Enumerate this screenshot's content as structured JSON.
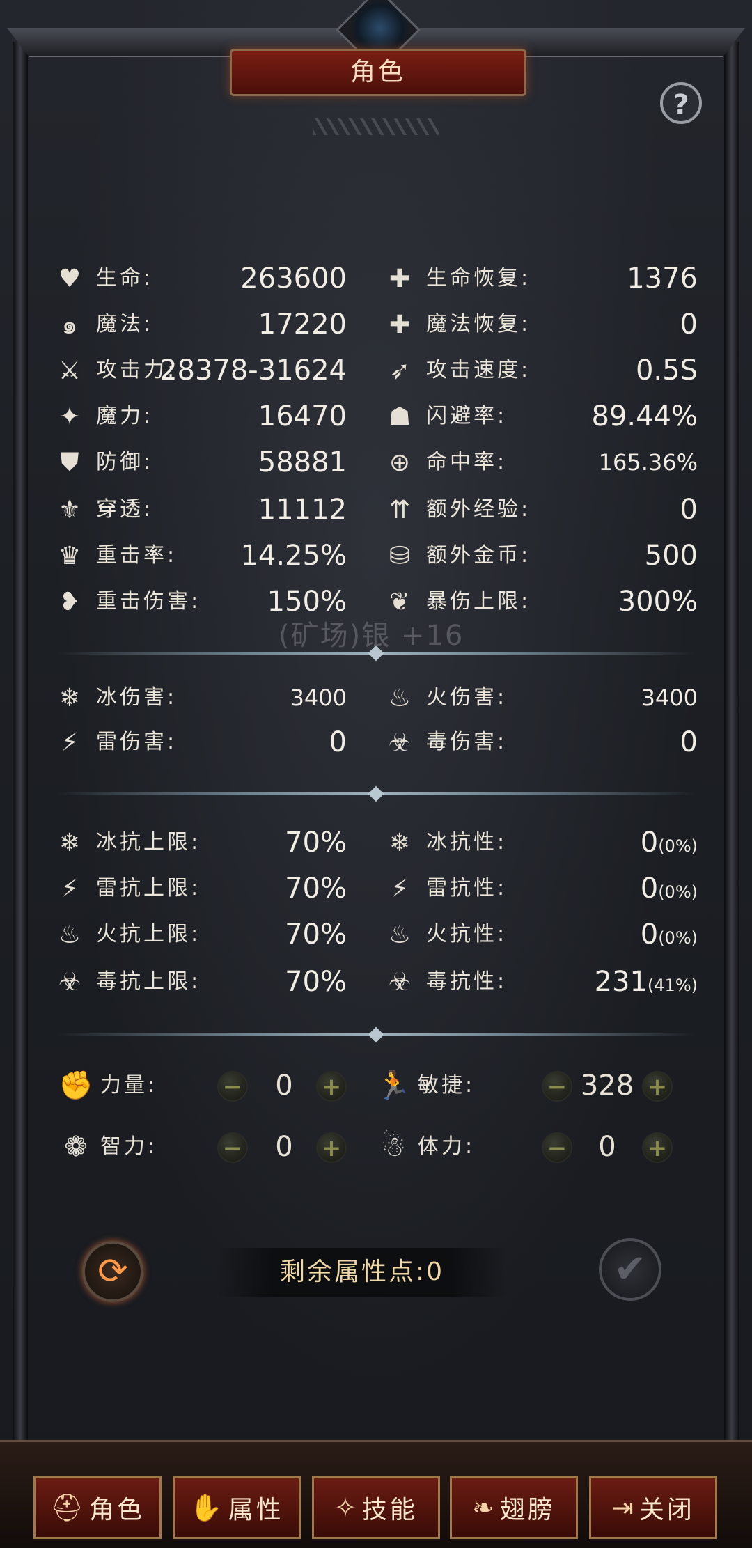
{
  "header": {
    "title": "角色",
    "help_icon": "?"
  },
  "watermark": "(矿场)银 +16",
  "stats_left": [
    {
      "icon": "heart-icon",
      "glyph": "♥",
      "label": "生命:",
      "value": "263600"
    },
    {
      "icon": "swirl-icon",
      "glyph": "๑",
      "label": "魔法:",
      "value": "17220"
    },
    {
      "icon": "sword-icon",
      "glyph": "⚔",
      "label": "攻击力:",
      "value": "28378-31624"
    },
    {
      "icon": "magic-staff-icon",
      "glyph": "✦",
      "label": "魔力:",
      "value": "16470"
    },
    {
      "icon": "shield-icon",
      "glyph": "⛊",
      "label": "防御:",
      "value": "58881"
    },
    {
      "icon": "penetrate-icon",
      "glyph": "⚜",
      "label": "穿透:",
      "value": "11112"
    },
    {
      "icon": "crit-rate-icon",
      "glyph": "♛",
      "label": "重击率:",
      "value": "14.25%"
    },
    {
      "icon": "crit-damage-icon",
      "glyph": "❥",
      "label": "重击伤害:",
      "value": "150%"
    }
  ],
  "stats_right": [
    {
      "icon": "heart-regen-icon",
      "glyph": "✚",
      "label": "生命恢复:",
      "value": "1376"
    },
    {
      "icon": "mana-regen-icon",
      "glyph": "✚",
      "label": "魔法恢复:",
      "value": "0"
    },
    {
      "icon": "attack-speed-icon",
      "glyph": "➶",
      "label": "攻击速度:",
      "value": "0.5S"
    },
    {
      "icon": "dodge-icon",
      "glyph": "☗",
      "label": "闪避率:",
      "value": "89.44%"
    },
    {
      "icon": "crosshair-icon",
      "glyph": "⊕",
      "label": "命中率:",
      "value": "165.36%"
    },
    {
      "icon": "extra-exp-icon",
      "glyph": "⇈",
      "label": "额外经验:",
      "value": "0"
    },
    {
      "icon": "extra-gold-icon",
      "glyph": "⛁",
      "label": "额外金币:",
      "value": "500"
    },
    {
      "icon": "crit-cap-icon",
      "glyph": "❦",
      "label": "暴伤上限:",
      "value": "300%"
    }
  ],
  "elemental_damage": {
    "left": [
      {
        "icon": "snowflake-icon",
        "glyph": "❄",
        "label": "冰伤害:",
        "value": "3400"
      },
      {
        "icon": "lightning-icon",
        "glyph": "⚡",
        "label": "雷伤害:",
        "value": "0"
      }
    ],
    "right": [
      {
        "icon": "fire-icon",
        "glyph": "♨",
        "label": "火伤害:",
        "value": "3400"
      },
      {
        "icon": "poison-icon",
        "glyph": "☣",
        "label": "毒伤害:",
        "value": "0"
      }
    ]
  },
  "resistances": {
    "left": [
      {
        "icon": "ice-resist-cap-icon",
        "glyph": "❄",
        "label": "冰抗上限:",
        "value": "70%"
      },
      {
        "icon": "thunder-resist-cap-icon",
        "glyph": "⚡",
        "label": "雷抗上限:",
        "value": "70%"
      },
      {
        "icon": "fire-resist-cap-icon",
        "glyph": "♨",
        "label": "火抗上限:",
        "value": "70%"
      },
      {
        "icon": "poison-resist-cap-icon",
        "glyph": "☣",
        "label": "毒抗上限:",
        "value": "70%"
      }
    ],
    "right": [
      {
        "icon": "ice-resist-icon",
        "glyph": "❄",
        "label": "冰抗性:",
        "value": "0",
        "pct": "(0%)"
      },
      {
        "icon": "thunder-resist-icon",
        "glyph": "⚡",
        "label": "雷抗性:",
        "value": "0",
        "pct": "(0%)"
      },
      {
        "icon": "fire-resist-icon",
        "glyph": "♨",
        "label": "火抗性:",
        "value": "0",
        "pct": "(0%)"
      },
      {
        "icon": "poison-resist-icon",
        "glyph": "☣",
        "label": "毒抗性:",
        "value": "231",
        "pct": "(41%)"
      }
    ]
  },
  "attributes": [
    {
      "icon": "fist-icon",
      "glyph": "✊",
      "label": "力量:",
      "value": "0"
    },
    {
      "icon": "runner-icon",
      "glyph": "🏃",
      "label": "敏捷:",
      "value": "328"
    },
    {
      "icon": "brain-icon",
      "glyph": "❁",
      "label": "智力:",
      "value": "0"
    },
    {
      "icon": "body-icon",
      "glyph": "☃",
      "label": "体力:",
      "value": "0"
    }
  ],
  "buttons": {
    "minus": "−",
    "plus": "+",
    "refresh": "⟳",
    "confirm": "✔"
  },
  "remaining_points": "剩余属性点:0",
  "tabs": [
    {
      "icon": "helmet-icon",
      "glyph": "⛑",
      "label": "角色"
    },
    {
      "icon": "flame-hand-icon",
      "glyph": "✋",
      "label": "属性"
    },
    {
      "icon": "skill-icon",
      "glyph": "✧",
      "label": "技能"
    },
    {
      "icon": "wing-icon",
      "glyph": "❧",
      "label": "翅膀"
    },
    {
      "icon": "exit-icon",
      "glyph": "⇥",
      "label": "关闭"
    }
  ]
}
